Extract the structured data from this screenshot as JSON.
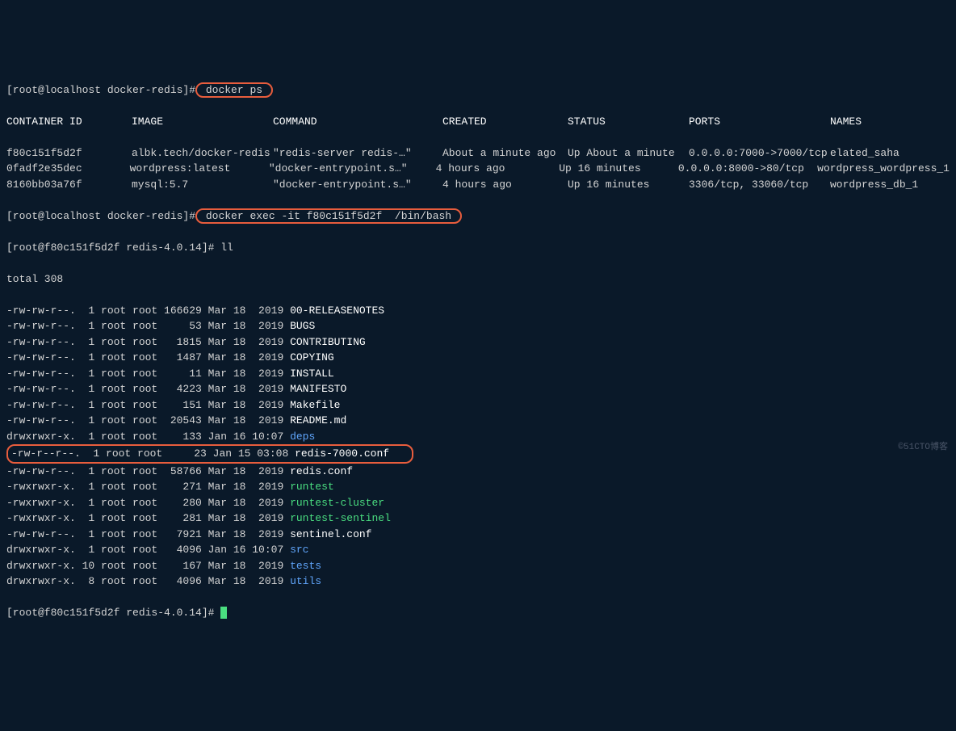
{
  "prompts": {
    "p1_prefix": "[root@localhost docker-redis]#",
    "p1_cmd": " docker ps ",
    "p2_prefix": "[root@localhost docker-redis]#",
    "p2_cmd": " docker exec -it f80c151f5d2f  /bin/bash ",
    "p3": "[root@f80c151f5d2f redis-4.0.14]# ll",
    "p4": "[root@f80c151f5d2f redis-4.0.14]# "
  },
  "headers": {
    "c1": "CONTAINER ID",
    "c2": "IMAGE",
    "c3": "COMMAND",
    "c4": "CREATED",
    "c5": "STATUS",
    "c6": "PORTS",
    "c7": "NAMES"
  },
  "containers": [
    {
      "id": "f80c151f5d2f",
      "image": "albk.tech/docker-redis",
      "command": "\"redis-server redis-…\"",
      "created": "About a minute ago",
      "status": "Up About a minute",
      "ports": "0.0.0.0:7000->7000/tcp",
      "names": "elated_saha"
    },
    {
      "id": "0fadf2e35dec",
      "image": "wordpress:latest",
      "command": "\"docker-entrypoint.s…\"",
      "created": "4 hours ago",
      "status": "Up 16 minutes",
      "ports": "0.0.0.0:8000->80/tcp",
      "names": "wordpress_wordpress_1"
    },
    {
      "id": "8160bb03a76f",
      "image": "mysql:5.7",
      "command": "\"docker-entrypoint.s…\"",
      "created": "4 hours ago",
      "status": "Up 16 minutes",
      "ports": "3306/tcp, 33060/tcp",
      "names": "wordpress_db_1"
    }
  ],
  "total": "total 308",
  "files": [
    {
      "perm": "-rw-rw-r--.",
      "links": " 1",
      "owner": "root",
      "group": "root",
      "size": "166629",
      "month": "Mar",
      "day": "18",
      "time": " 2019",
      "name": "00-RELEASENOTES",
      "color": "white"
    },
    {
      "perm": "-rw-rw-r--.",
      "links": " 1",
      "owner": "root",
      "group": "root",
      "size": "    53",
      "month": "Mar",
      "day": "18",
      "time": " 2019",
      "name": "BUGS",
      "color": "white"
    },
    {
      "perm": "-rw-rw-r--.",
      "links": " 1",
      "owner": "root",
      "group": "root",
      "size": "  1815",
      "month": "Mar",
      "day": "18",
      "time": " 2019",
      "name": "CONTRIBUTING",
      "color": "white"
    },
    {
      "perm": "-rw-rw-r--.",
      "links": " 1",
      "owner": "root",
      "group": "root",
      "size": "  1487",
      "month": "Mar",
      "day": "18",
      "time": " 2019",
      "name": "COPYING",
      "color": "white"
    },
    {
      "perm": "-rw-rw-r--.",
      "links": " 1",
      "owner": "root",
      "group": "root",
      "size": "    11",
      "month": "Mar",
      "day": "18",
      "time": " 2019",
      "name": "INSTALL",
      "color": "white"
    },
    {
      "perm": "-rw-rw-r--.",
      "links": " 1",
      "owner": "root",
      "group": "root",
      "size": "  4223",
      "month": "Mar",
      "day": "18",
      "time": " 2019",
      "name": "MANIFESTO",
      "color": "white"
    },
    {
      "perm": "-rw-rw-r--.",
      "links": " 1",
      "owner": "root",
      "group": "root",
      "size": "   151",
      "month": "Mar",
      "day": "18",
      "time": " 2019",
      "name": "Makefile",
      "color": "white"
    },
    {
      "perm": "-rw-rw-r--.",
      "links": " 1",
      "owner": "root",
      "group": "root",
      "size": " 20543",
      "month": "Mar",
      "day": "18",
      "time": " 2019",
      "name": "README.md",
      "color": "white"
    },
    {
      "perm": "drwxrwxr-x.",
      "links": " 1",
      "owner": "root",
      "group": "root",
      "size": "   133",
      "month": "Jan",
      "day": "16",
      "time": "10:07",
      "name": "deps",
      "color": "blue"
    },
    {
      "perm": "-rw-r--r--.",
      "links": " 1",
      "owner": "root",
      "group": "root",
      "size": "    23",
      "month": "Jan",
      "day": "15",
      "time": "03:08",
      "name": "redis-7000.conf",
      "color": "white",
      "boxed": true
    },
    {
      "perm": "-rw-rw-r--.",
      "links": " 1",
      "owner": "root",
      "group": "root",
      "size": " 58766",
      "month": "Mar",
      "day": "18",
      "time": " 2019",
      "name": "redis.conf",
      "color": "white"
    },
    {
      "perm": "-rwxrwxr-x.",
      "links": " 1",
      "owner": "root",
      "group": "root",
      "size": "   271",
      "month": "Mar",
      "day": "18",
      "time": " 2019",
      "name": "runtest",
      "color": "green"
    },
    {
      "perm": "-rwxrwxr-x.",
      "links": " 1",
      "owner": "root",
      "group": "root",
      "size": "   280",
      "month": "Mar",
      "day": "18",
      "time": " 2019",
      "name": "runtest-cluster",
      "color": "green"
    },
    {
      "perm": "-rwxrwxr-x.",
      "links": " 1",
      "owner": "root",
      "group": "root",
      "size": "   281",
      "month": "Mar",
      "day": "18",
      "time": " 2019",
      "name": "runtest-sentinel",
      "color": "green"
    },
    {
      "perm": "-rw-rw-r--.",
      "links": " 1",
      "owner": "root",
      "group": "root",
      "size": "  7921",
      "month": "Mar",
      "day": "18",
      "time": " 2019",
      "name": "sentinel.conf",
      "color": "white"
    },
    {
      "perm": "drwxrwxr-x.",
      "links": " 1",
      "owner": "root",
      "group": "root",
      "size": "  4096",
      "month": "Jan",
      "day": "16",
      "time": "10:07",
      "name": "src",
      "color": "blue"
    },
    {
      "perm": "drwxrwxr-x.",
      "links": "10",
      "owner": "root",
      "group": "root",
      "size": "   167",
      "month": "Mar",
      "day": "18",
      "time": " 2019",
      "name": "tests",
      "color": "blue"
    },
    {
      "perm": "drwxrwxr-x.",
      "links": " 8",
      "owner": "root",
      "group": "root",
      "size": "  4096",
      "month": "Mar",
      "day": "18",
      "time": " 2019",
      "name": "utils",
      "color": "blue"
    }
  ],
  "watermark": "©51CTO博客"
}
